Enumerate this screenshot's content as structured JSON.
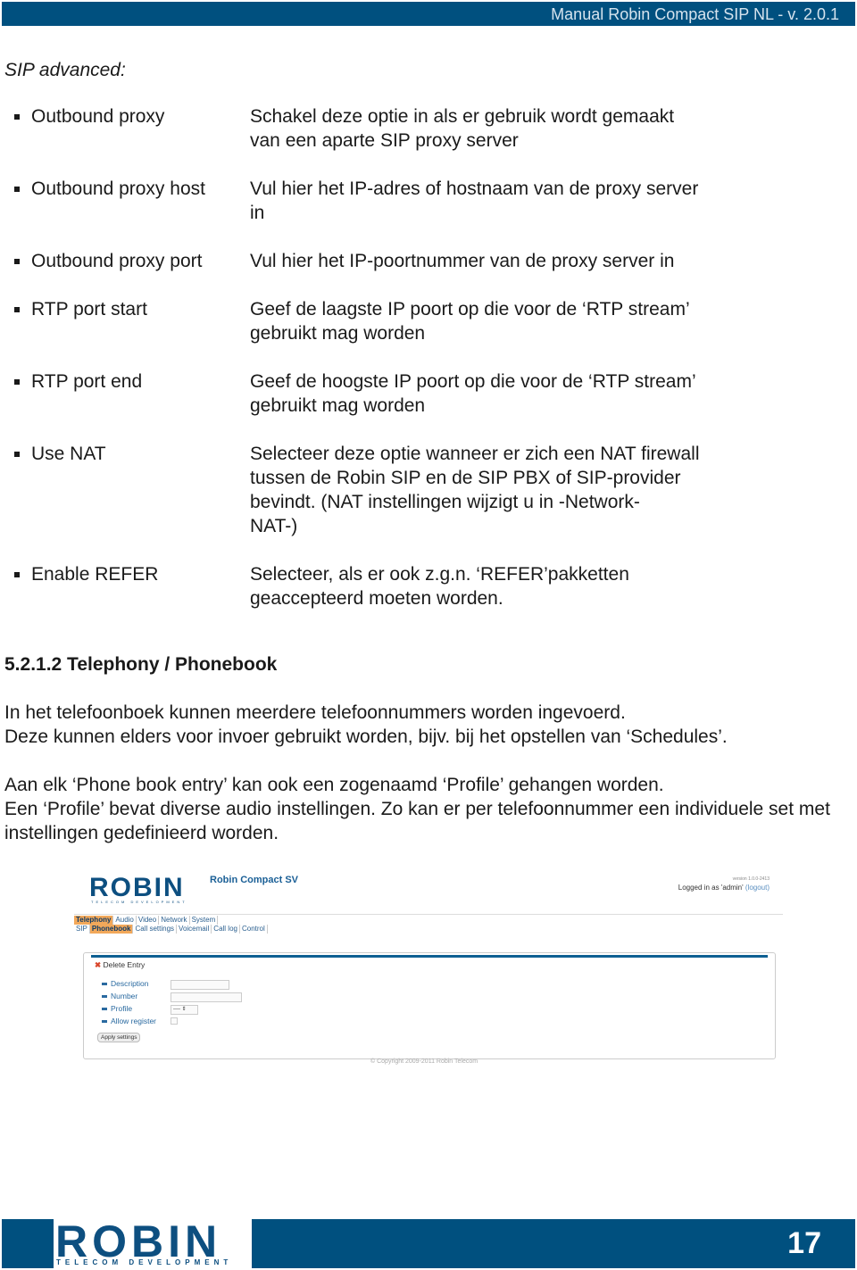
{
  "header": {
    "title": "Manual Robin Compact SIP NL - v. 2.0.1"
  },
  "section_heading": "SIP advanced:",
  "items": [
    {
      "term": "Outbound proxy",
      "desc": [
        "Schakel deze optie in als er gebruik wordt gemaakt",
        "van een aparte SIP proxy server"
      ]
    },
    {
      "term": "Outbound proxy host",
      "desc": [
        "Vul hier het IP-adres of hostnaam van de proxy server",
        "in"
      ]
    },
    {
      "term": "Outbound proxy port",
      "desc": [
        "Vul hier het IP-poortnummer van de proxy server in"
      ]
    },
    {
      "term": "RTP port start",
      "desc": [
        "Geef de laagste IP poort op die voor de ‘RTP stream’",
        "gebruikt mag worden"
      ]
    },
    {
      "term": "RTP port end",
      "desc": [
        "Geef de hoogste IP poort op die voor de ‘RTP stream’",
        "gebruikt mag worden"
      ]
    },
    {
      "term": "Use NAT",
      "desc": [
        "Selecteer deze optie wanneer er zich een NAT firewall",
        "tussen de Robin SIP en de SIP PBX of SIP-provider",
        "bevindt. (NAT instellingen wijzigt u in -Network-",
        "NAT-)"
      ]
    },
    {
      "term": "Enable REFER",
      "desc": [
        "Selecteer, als er ook z.g.n. ‘REFER’pakketten",
        "geaccepteerd moeten worden."
      ]
    }
  ],
  "subsection_title": "5.2.1.2 Telephony / Phonebook",
  "paragraphs": [
    [
      "In het telefoonboek kunnen meerdere telefoonnummers worden ingevoerd.",
      "Deze kunnen elders voor invoer gebruikt worden, bijv. bij het opstellen van ‘Schedules’."
    ],
    [
      "Aan elk ‘Phone book entry’ kan ook een zogenaamd ‘Profile’ gehangen worden.",
      "Een ‘Profile’ bevat diverse audio instellingen. Zo kan er per telefoonnummer een individuele set met",
      "instellingen gedefinieerd worden."
    ]
  ],
  "screenshot": {
    "logo": "ROBIN",
    "logo_sub": "TELECOM DEVELOPMENT",
    "product": "Robin Compact SV",
    "version": "version 1.0.0-2413",
    "logged_in": "Logged in as 'admin'",
    "logout": "(logout)",
    "main_tabs": [
      "Telephony",
      "Audio",
      "Video",
      "Network",
      "System"
    ],
    "sub_tabs": [
      "SIP",
      "Phonebook",
      "Call settings",
      "Voicemail",
      "Call log",
      "Control"
    ],
    "delete_entry": "Delete Entry",
    "fields": [
      "Description",
      "Number",
      "Profile",
      "Allow register"
    ],
    "profile_value": "----",
    "apply": "Apply settings",
    "copyright": "© Copyright 2009-2011 Robin Telecom"
  },
  "footer": {
    "logo": "ROBIN",
    "logo_sub": "TELECOM DEVELOPMENT",
    "page_number": "17"
  },
  "colors": {
    "brand_blue": "#00507f",
    "tab_active": "#f2a85a"
  }
}
